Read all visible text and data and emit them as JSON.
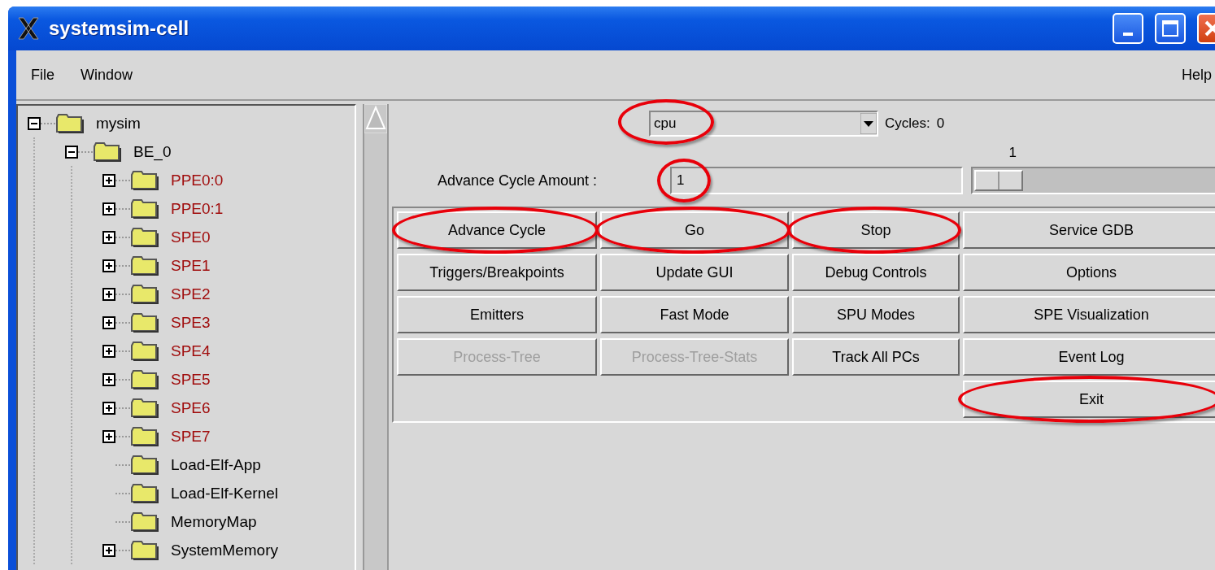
{
  "window": {
    "title": "systemsim-cell"
  },
  "menu": {
    "left": [
      "File",
      "Window"
    ],
    "right": [
      "Help"
    ]
  },
  "tree": [
    {
      "label": "mysim",
      "kind": "branch",
      "expanded": true,
      "color": "#000000",
      "children": [
        {
          "label": "BE_0",
          "kind": "branch",
          "expanded": true,
          "color": "#000000",
          "children": [
            {
              "label": "PPE0:0",
              "kind": "branch",
              "expanded": false,
              "color": "#a00c0c"
            },
            {
              "label": "PPE0:1",
              "kind": "branch",
              "expanded": false,
              "color": "#a00c0c"
            },
            {
              "label": "SPE0",
              "kind": "branch",
              "expanded": false,
              "color": "#a00c0c"
            },
            {
              "label": "SPE1",
              "kind": "branch",
              "expanded": false,
              "color": "#a00c0c"
            },
            {
              "label": "SPE2",
              "kind": "branch",
              "expanded": false,
              "color": "#a00c0c"
            },
            {
              "label": "SPE3",
              "kind": "branch",
              "expanded": false,
              "color": "#a00c0c"
            },
            {
              "label": "SPE4",
              "kind": "branch",
              "expanded": false,
              "color": "#a00c0c"
            },
            {
              "label": "SPE5",
              "kind": "branch",
              "expanded": false,
              "color": "#a00c0c"
            },
            {
              "label": "SPE6",
              "kind": "branch",
              "expanded": false,
              "color": "#a00c0c"
            },
            {
              "label": "SPE7",
              "kind": "branch",
              "expanded": false,
              "color": "#a00c0c"
            },
            {
              "label": "Load-Elf-App",
              "kind": "leaf",
              "color": "#000000"
            },
            {
              "label": "Load-Elf-Kernel",
              "kind": "leaf",
              "color": "#000000"
            },
            {
              "label": "MemoryMap",
              "kind": "leaf",
              "color": "#000000"
            },
            {
              "label": "SystemMemory",
              "kind": "branch",
              "expanded": false,
              "color": "#000000"
            }
          ]
        }
      ]
    }
  ],
  "cpu_select": {
    "value": "cpu",
    "highlighted": true
  },
  "cycles": {
    "label": "Cycles:",
    "value": "0"
  },
  "advance": {
    "label": "Advance Cycle Amount :",
    "value": "1",
    "highlighted": true
  },
  "slider": {
    "reading": "1",
    "level": 0
  },
  "buttons": [
    [
      {
        "label": "Advance Cycle",
        "disabled": false,
        "highlighted": true
      },
      {
        "label": "Go",
        "disabled": false,
        "highlighted": true
      },
      {
        "label": "Stop",
        "disabled": false,
        "highlighted": true
      },
      {
        "label": "Service GDB",
        "disabled": false,
        "highlighted": false
      }
    ],
    [
      {
        "label": "Triggers/Breakpoints",
        "disabled": false,
        "highlighted": false
      },
      {
        "label": "Update GUI",
        "disabled": false,
        "highlighted": false
      },
      {
        "label": "Debug Controls",
        "disabled": false,
        "highlighted": false
      },
      {
        "label": "Options",
        "disabled": false,
        "highlighted": false
      }
    ],
    [
      {
        "label": "Emitters",
        "disabled": false,
        "highlighted": false
      },
      {
        "label": "Fast Mode",
        "disabled": false,
        "highlighted": false
      },
      {
        "label": "SPU Modes",
        "disabled": false,
        "highlighted": false
      },
      {
        "label": "SPE Visualization",
        "disabled": false,
        "highlighted": false
      }
    ],
    [
      {
        "label": "Process-Tree",
        "disabled": true,
        "highlighted": false
      },
      {
        "label": "Process-Tree-Stats",
        "disabled": true,
        "highlighted": false
      },
      {
        "label": "Track All PCs",
        "disabled": false,
        "highlighted": false
      },
      {
        "label": "Event Log",
        "disabled": false,
        "highlighted": false
      }
    ],
    [
      {
        "label": "Exit",
        "disabled": false,
        "highlighted": true
      }
    ]
  ]
}
